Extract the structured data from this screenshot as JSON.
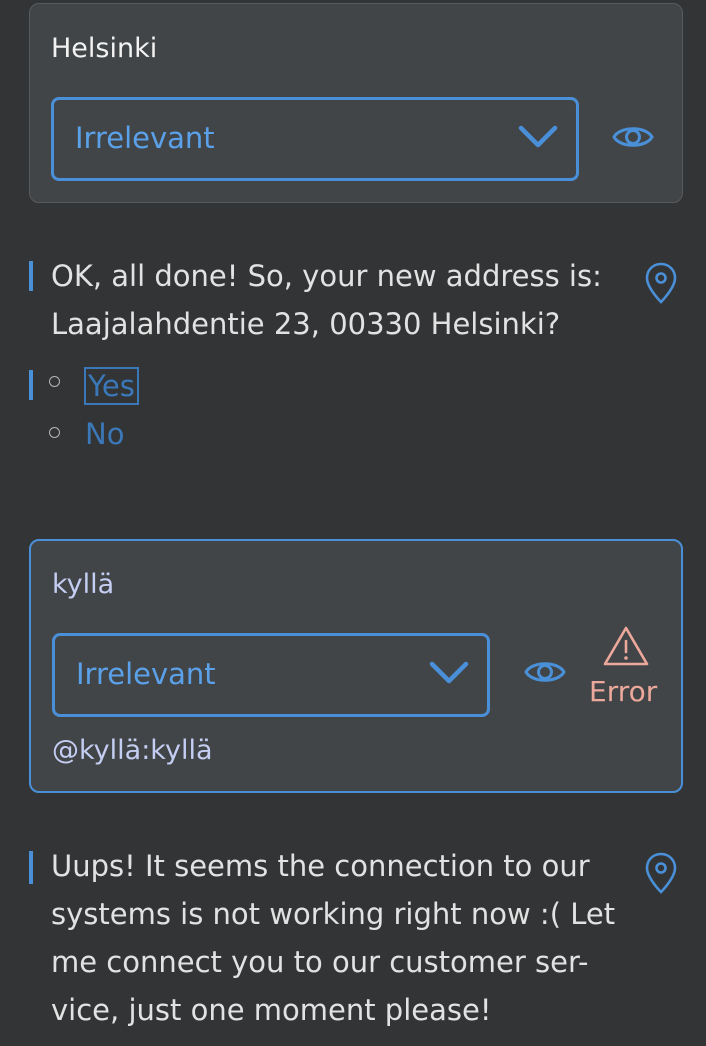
{
  "card1": {
    "title": "Helsinki",
    "select_value": "Irrelevant"
  },
  "message1": {
    "lines": [
      "OK, all done! So, your new address is:",
      "Laajalahdentie 23, 00330 Helsinki?"
    ]
  },
  "options": [
    {
      "label": "Yes",
      "focused": true
    },
    {
      "label": "No",
      "focused": false
    }
  ],
  "card2": {
    "title": "kyllä",
    "select_value": "Irrelevant",
    "error_label": "Error",
    "mention": "@kyllä:kyllä"
  },
  "message2": {
    "lines": [
      "Uups! It seems the connection to our",
      "systems is not working right now :( Let",
      "me connect you to our customer ser-",
      "vice, just one moment please!"
    ]
  },
  "colors": {
    "background": "#333435",
    "card": "#424547",
    "accent": "#4a90d9",
    "link": "#5ba1ea",
    "option": "#3b78b9",
    "error": "#eba89b",
    "mention": "#c4cdf2"
  },
  "icons": [
    "chevron-down-icon",
    "eye-icon",
    "location-pin-icon",
    "warning-icon"
  ]
}
